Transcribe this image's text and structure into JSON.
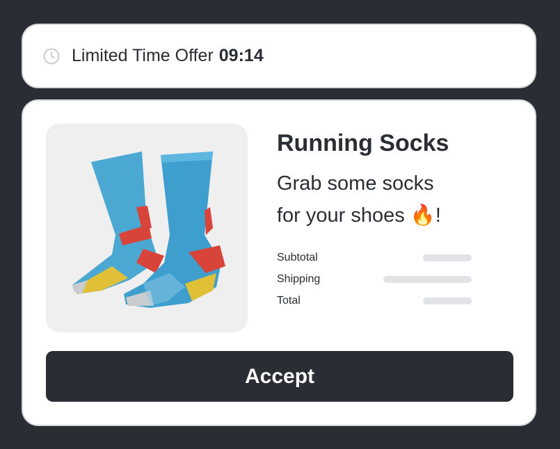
{
  "offer_timer": {
    "icon": "clock-icon",
    "label": "Limited Time Offer",
    "countdown": "09:14"
  },
  "product": {
    "image_alt": "Running socks",
    "title": "Running Socks",
    "description_line1": "Grab some socks",
    "description_line2": "for your shoes 🔥!"
  },
  "summary": {
    "subtotal_label": "Subtotal",
    "shipping_label": "Shipping",
    "total_label": "Total"
  },
  "actions": {
    "accept_label": "Accept"
  },
  "colors": {
    "background": "#2a2d34",
    "card": "#ffffff",
    "button": "#2a2d34",
    "placeholder": "#e2e3e6"
  }
}
